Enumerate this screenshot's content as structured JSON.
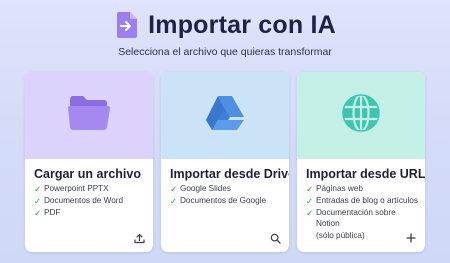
{
  "header": {
    "title": "Importar con IA",
    "subtitle": "Selecciona el archivo que quieras transformar",
    "app_icon": "import-document-icon"
  },
  "cards": [
    {
      "title": "Cargar un archivo",
      "icon": "folder-icon",
      "action_icon": "upload-icon",
      "features": [
        "Powerpoint PPTX",
        "Documentos de Word",
        "PDF"
      ]
    },
    {
      "title": "Importar desde Drive",
      "icon": "google-drive-icon",
      "action_icon": "search-icon",
      "features": [
        "Google Slides",
        "Documentos de Google"
      ]
    },
    {
      "title": "Importar desde URL",
      "icon": "globe-icon",
      "action_icon": "plus-icon",
      "features": [
        "Páginas web",
        "Entradas de blog o artículos",
        "Documentación sobre Notion",
        "(sólo pública)"
      ]
    }
  ],
  "colors": {
    "card1_bg": "#dcd2fb",
    "card2_bg": "#cbe3f6",
    "card3_bg": "#c3efe6",
    "check": "#2aa84a",
    "accent_purple": "#8f6fe8"
  }
}
